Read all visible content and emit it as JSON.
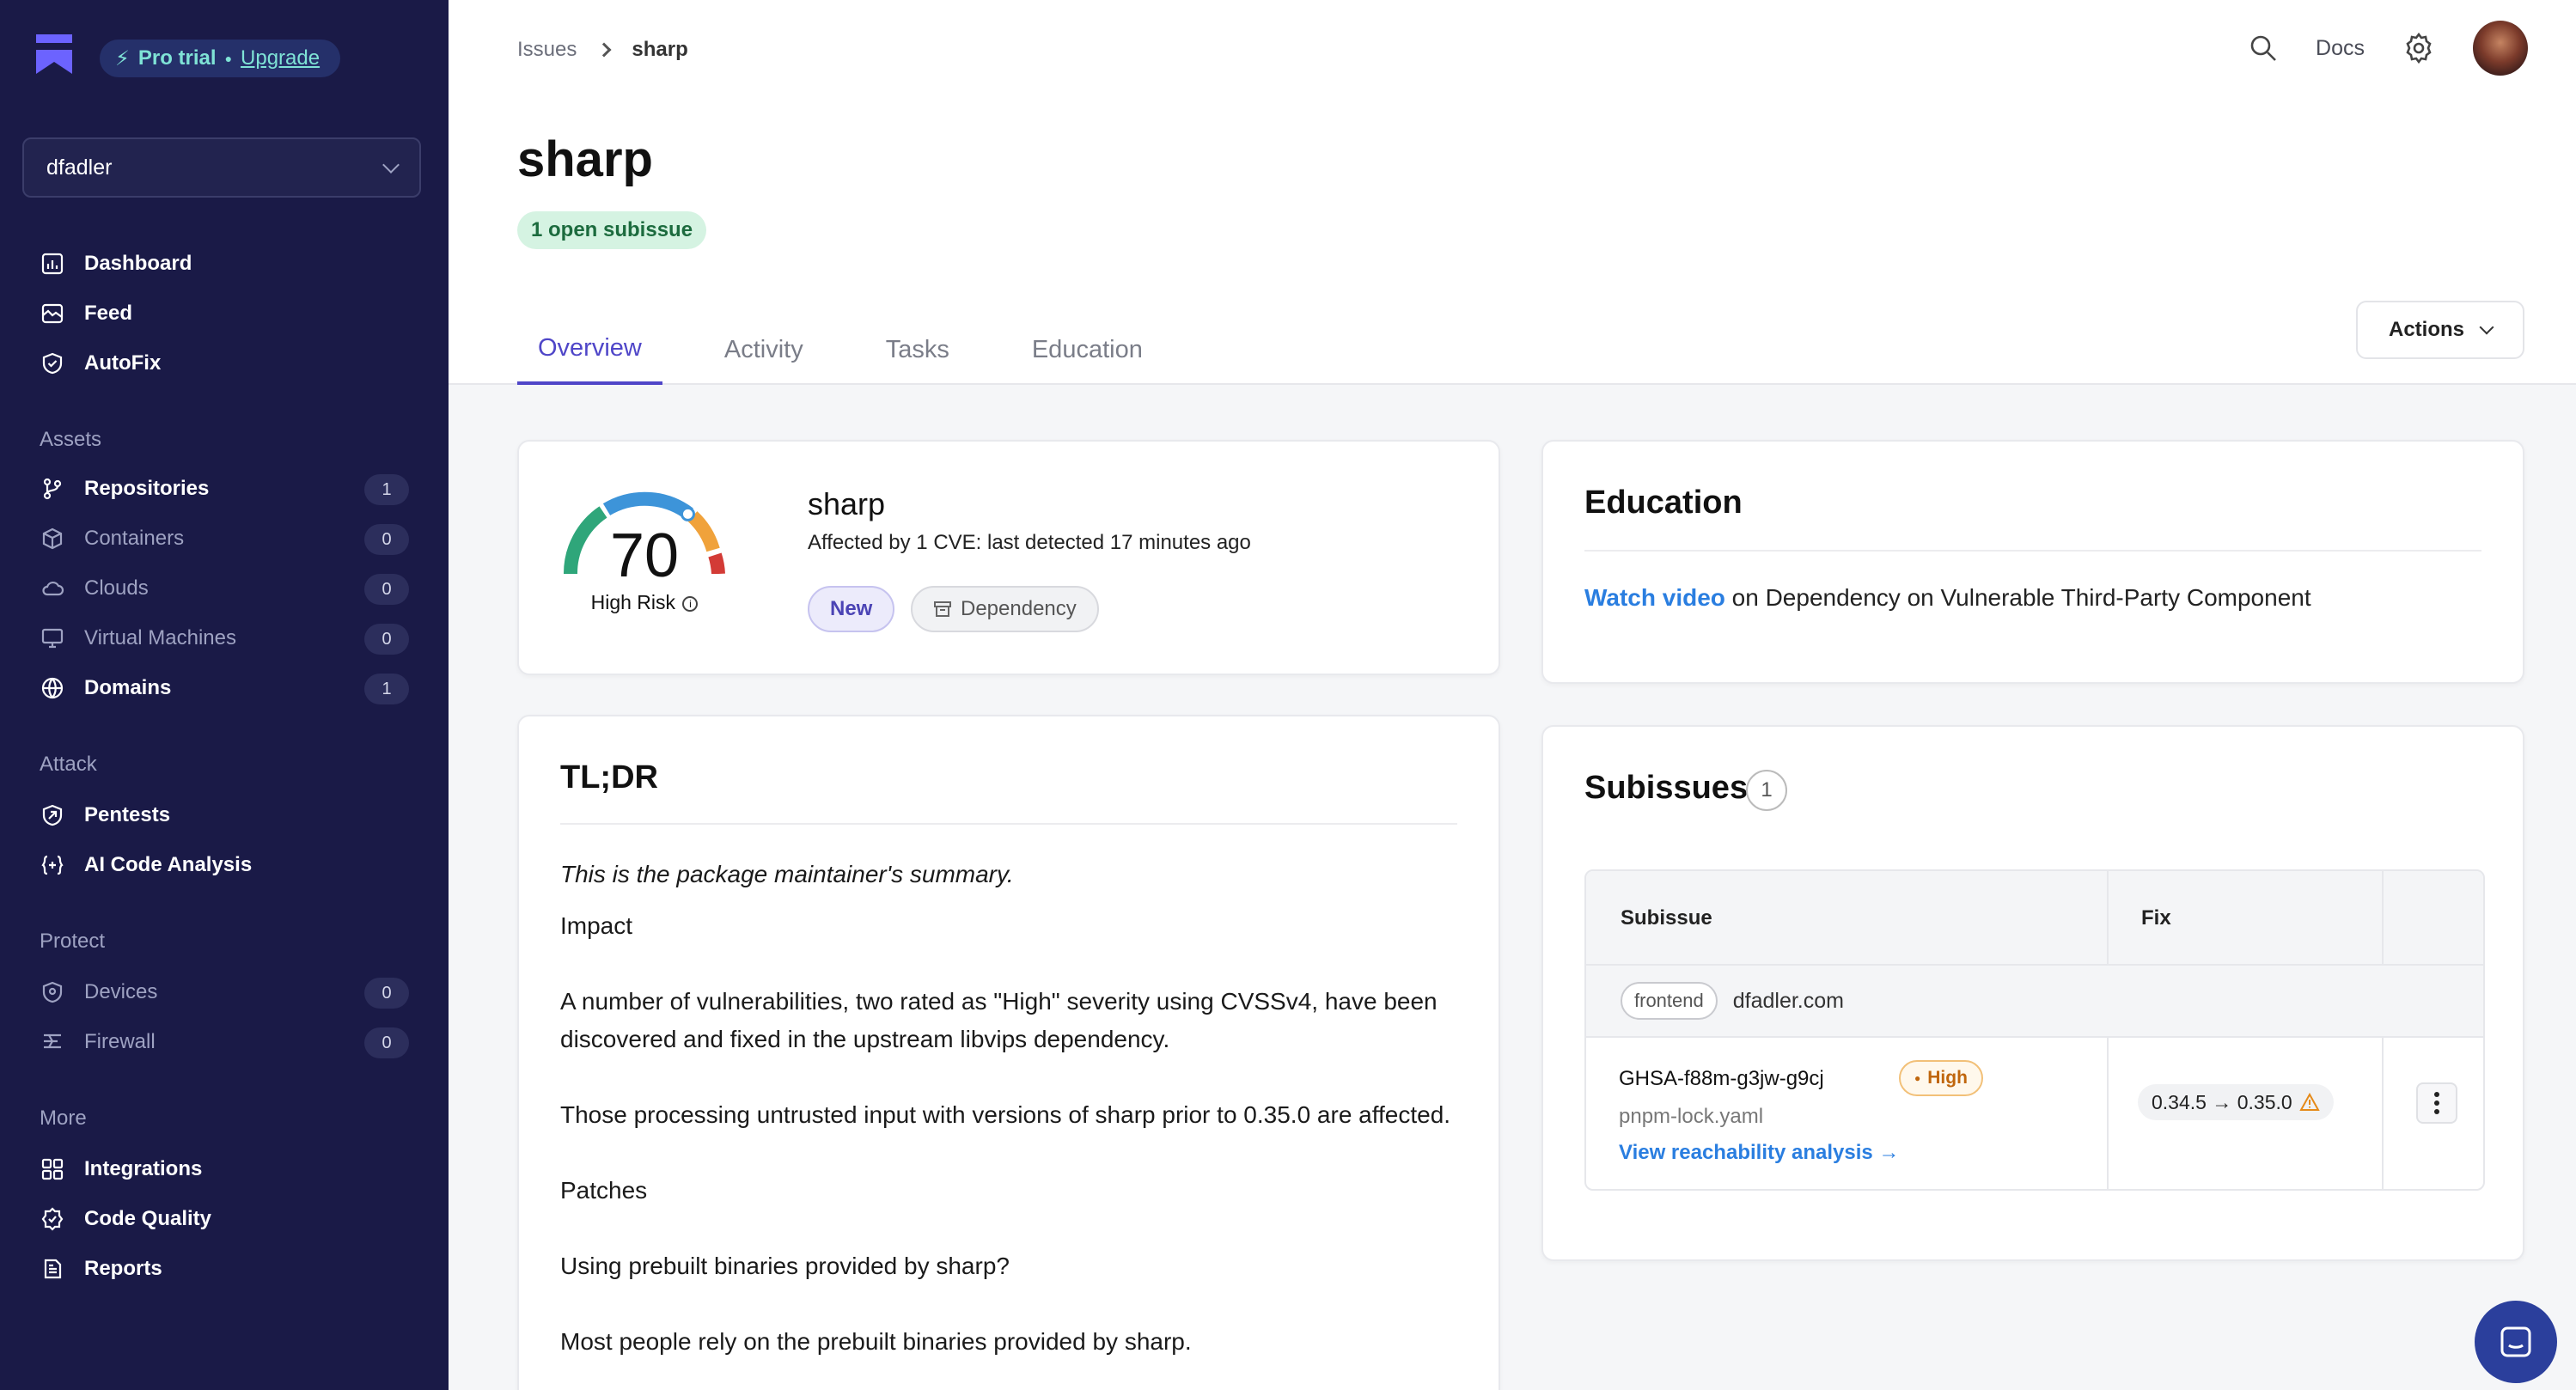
{
  "brand": {
    "plan_label": "Pro trial",
    "upgrade_label": "Upgrade"
  },
  "org": {
    "name": "dfadler"
  },
  "sidebar": {
    "main": [
      {
        "label": "Dashboard",
        "icon": "dashboard-icon"
      },
      {
        "label": "Feed",
        "icon": "feed-icon"
      },
      {
        "label": "AutoFix",
        "icon": "shield-check-icon"
      }
    ],
    "assets_title": "Assets",
    "assets": [
      {
        "label": "Repositories",
        "count": "1",
        "icon": "git-icon"
      },
      {
        "label": "Containers",
        "count": "0",
        "icon": "box-icon"
      },
      {
        "label": "Clouds",
        "count": "0",
        "icon": "cloud-icon"
      },
      {
        "label": "Virtual Machines",
        "count": "0",
        "icon": "monitor-icon"
      },
      {
        "label": "Domains",
        "count": "1",
        "icon": "globe-icon"
      }
    ],
    "attack_title": "Attack",
    "attack": [
      {
        "label": "Pentests",
        "icon": "pentest-icon"
      },
      {
        "label": "AI Code Analysis",
        "icon": "ai-code-icon"
      }
    ],
    "protect_title": "Protect",
    "protect": [
      {
        "label": "Devices",
        "count": "0",
        "icon": "device-shield-icon"
      },
      {
        "label": "Firewall",
        "count": "0",
        "icon": "firewall-icon"
      }
    ],
    "more_title": "More",
    "more": [
      {
        "label": "Integrations",
        "icon": "grid-icon"
      },
      {
        "label": "Code Quality",
        "icon": "badge-icon"
      },
      {
        "label": "Reports",
        "icon": "report-icon"
      }
    ]
  },
  "header": {
    "breadcrumb_root": "Issues",
    "breadcrumb_current": "sharp",
    "docs_label": "Docs"
  },
  "issue": {
    "title": "sharp",
    "open_subissues": "1 open subissue",
    "tabs": [
      "Overview",
      "Activity",
      "Tasks",
      "Education"
    ],
    "actions_label": "Actions"
  },
  "score_card": {
    "score": "70",
    "score_value": 70,
    "risk_label": "High Risk",
    "package": "sharp",
    "summary": "Affected by 1 CVE: last detected 17 minutes ago",
    "tag_new": "New",
    "tag_dependency": "Dependency"
  },
  "education": {
    "title": "Education",
    "link_text": "Watch video",
    "text": "on Dependency on Vulnerable Third-Party Component"
  },
  "tldr": {
    "title": "TL;DR",
    "intro": "This is the package maintainer's summary.",
    "impact_heading": "Impact",
    "p1": "A number of vulnerabilities, two rated as \"High\" severity using CVSSv4, have been discovered and fixed in the upstream libvips dependency.",
    "p2": "Those processing untrusted input with versions of sharp prior to 0.35.0 are affected.",
    "patches_heading": "Patches",
    "p3": "Using prebuilt binaries provided by sharp?",
    "p4": "Most people rely on the prebuilt binaries provided by sharp."
  },
  "subissues": {
    "title": "Subissues",
    "count": "1",
    "col_subissue": "Subissue",
    "col_fix": "Fix",
    "group_tag": "frontend",
    "group_domain": "dfadler.com",
    "row_id": "GHSA-f88m-g3jw-g9cj",
    "severity": "High",
    "file": "pnpm-lock.yaml",
    "reachability_link": "View reachability analysis →",
    "fix": "0.34.5 → 0.35.0"
  },
  "colors": {
    "sidebar_bg": "#1a1a47",
    "accent": "#4f46c8",
    "link": "#2a7ee0",
    "high": "#c0660c"
  }
}
